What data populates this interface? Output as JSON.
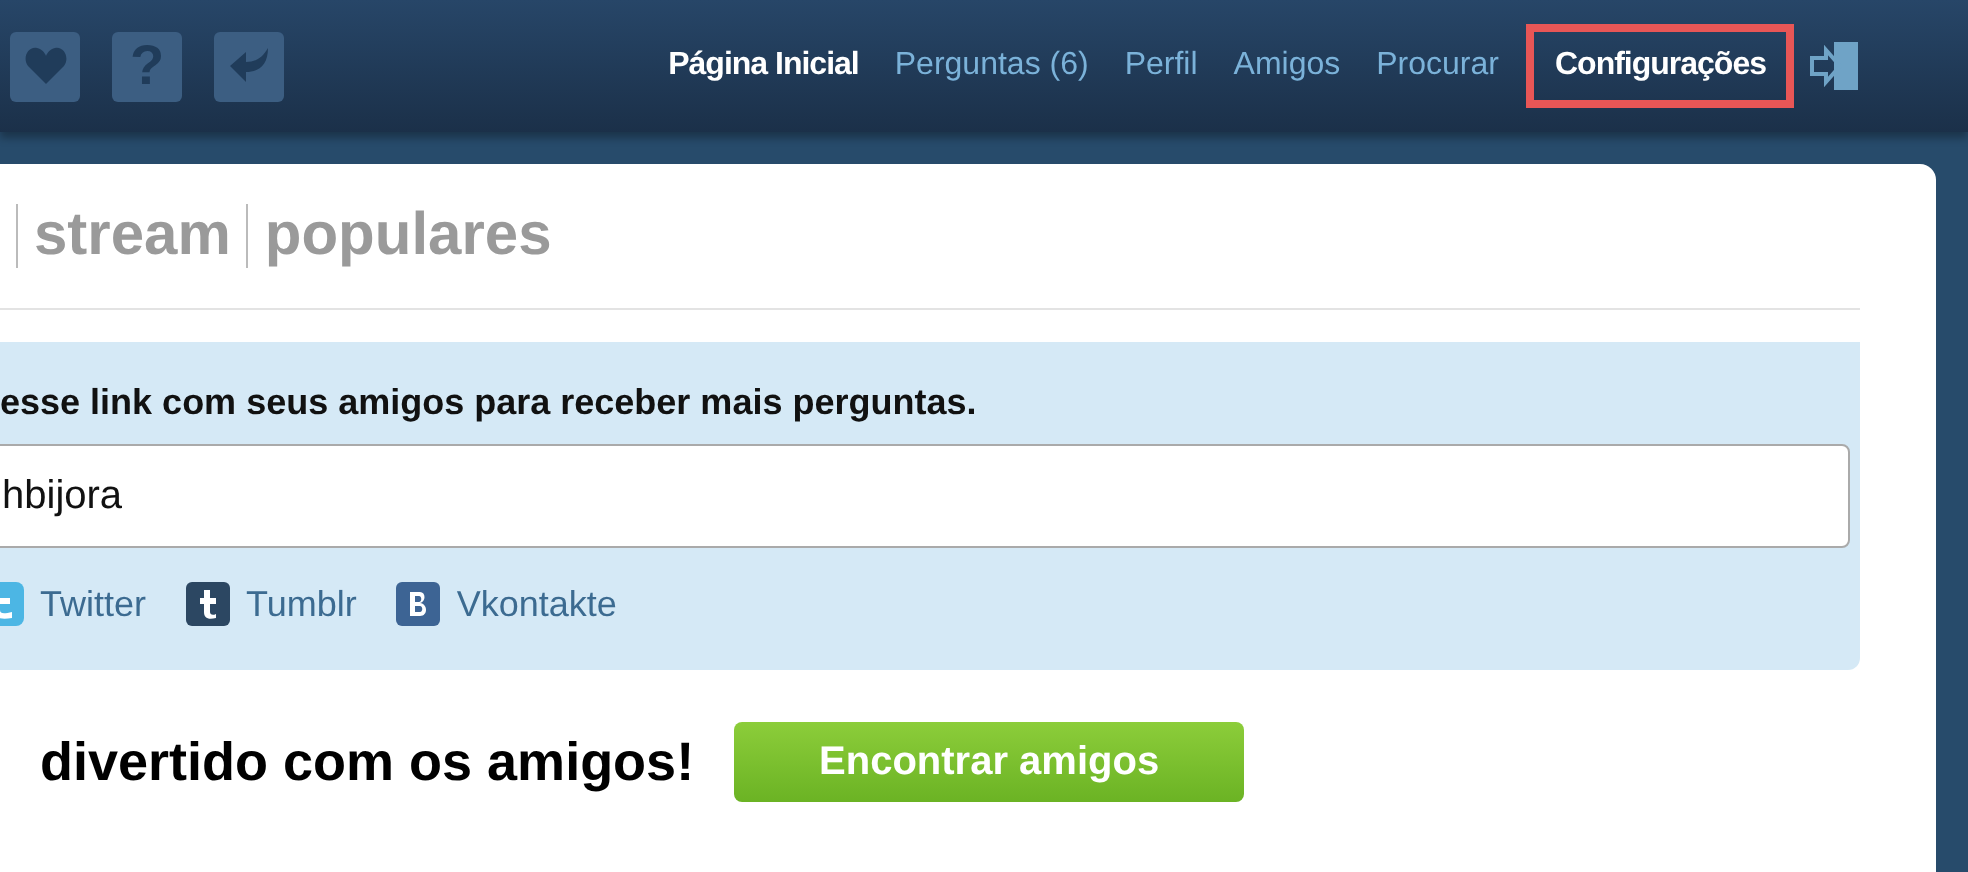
{
  "toolbar_icons": [
    {
      "kind": "heart"
    },
    {
      "kind": "text",
      "label": "?"
    },
    {
      "kind": "reply"
    }
  ],
  "nav": [
    {
      "label": "Página Inicial",
      "selected": true,
      "highlighted": false
    },
    {
      "label": "Perguntas (6)",
      "selected": false,
      "highlighted": false
    },
    {
      "label": "Perfil",
      "selected": false,
      "highlighted": false
    },
    {
      "label": "Amigos",
      "selected": false,
      "highlighted": false
    },
    {
      "label": "Procurar",
      "selected": false,
      "highlighted": false
    },
    {
      "label": "Configurações",
      "selected": true,
      "highlighted": true
    }
  ],
  "tabs": [
    {
      "label": "stream",
      "selected": false
    },
    {
      "label": "populares",
      "selected": false
    }
  ],
  "share_box": {
    "message": "esse link com seus amigos para receber mais perguntas.",
    "link_value": "hbijora",
    "services": [
      {
        "kind": "twitter",
        "label": "Twitter"
      },
      {
        "kind": "tumblr",
        "label": "Tumblr"
      },
      {
        "kind": "vk",
        "label": "Vkontakte"
      }
    ]
  },
  "friends": {
    "heading": "divertido com os amigos!",
    "button": "Encontrar amigos"
  }
}
